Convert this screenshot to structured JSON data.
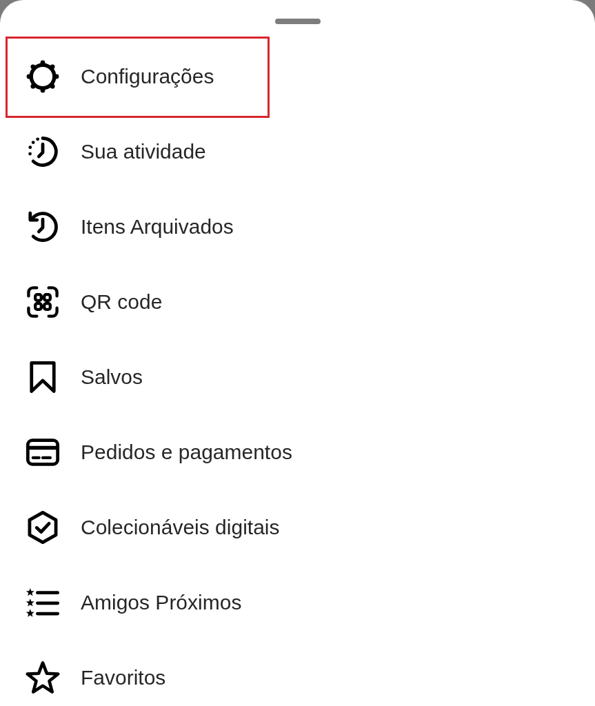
{
  "menu_items": [
    {
      "kind": "settings",
      "label": "Configurações",
      "highlighted": true
    },
    {
      "kind": "activity",
      "label": "Sua atividade",
      "highlighted": false
    },
    {
      "kind": "archive",
      "label": "Itens Arquivados",
      "highlighted": false
    },
    {
      "kind": "qr",
      "label": "QR code",
      "highlighted": false
    },
    {
      "kind": "saved",
      "label": "Salvos",
      "highlighted": false
    },
    {
      "kind": "payments",
      "label": "Pedidos e pagamentos",
      "highlighted": false
    },
    {
      "kind": "collectibles",
      "label": "Colecionáveis digitais",
      "highlighted": false
    },
    {
      "kind": "close_friends",
      "label": "Amigos Próximos",
      "highlighted": false
    },
    {
      "kind": "favorites",
      "label": "Favoritos",
      "highlighted": false
    }
  ]
}
